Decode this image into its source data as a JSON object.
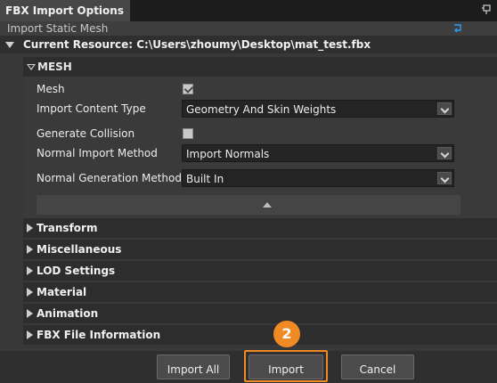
{
  "window": {
    "title": "FBX Import Options",
    "subheader": "Import Static Mesh",
    "current_resource": "Current Resource: C:\\Users\\zhoumy\\Desktop\\mat_test.fbx"
  },
  "mesh_section": {
    "title": "MESH",
    "properties": {
      "mesh_label": "Mesh",
      "mesh_checked": true,
      "import_content_type_label": "Import Content Type",
      "import_content_type_value": "Geometry And Skin Weights",
      "generate_collision_label": "Generate Collision",
      "generate_collision_checked": false,
      "normal_import_method_label": "Normal Import Method",
      "normal_import_method_value": "Import Normals",
      "normal_generation_method_label": "Normal Generation Method",
      "normal_generation_method_value": "Built In"
    }
  },
  "sections": [
    {
      "label": "Transform"
    },
    {
      "label": "Miscellaneous"
    },
    {
      "label": "LOD Settings"
    },
    {
      "label": "Material"
    },
    {
      "label": "Animation"
    },
    {
      "label": "FBX File Information"
    }
  ],
  "buttons": {
    "import_all": "Import All",
    "import": "Import",
    "cancel": "Cancel"
  },
  "annotation": {
    "step_number": "2",
    "accent_color": "#f08a24"
  },
  "icons": {
    "pin": "pin-icon",
    "back": "back-icon"
  }
}
